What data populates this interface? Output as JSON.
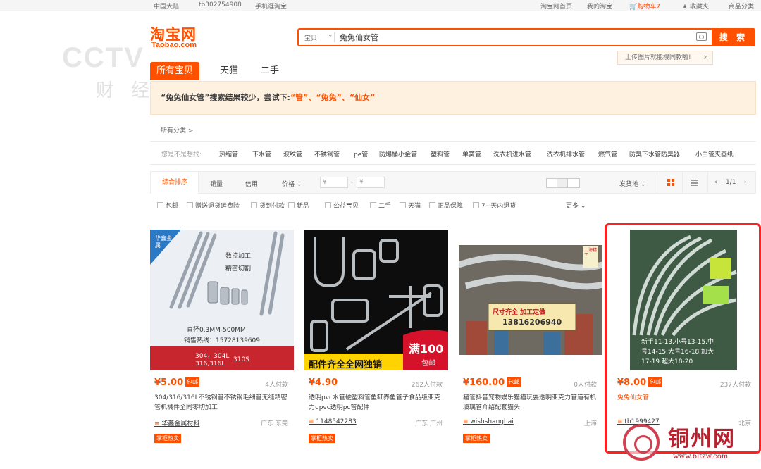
{
  "topbar": {
    "region": "中国大陆",
    "user": "tb302754908",
    "mobile": "手机逛淘宝",
    "home": "淘宝网首页",
    "my": "我的淘宝",
    "cart": "购物车7",
    "fav": "收藏夹",
    "cats": "商品分类"
  },
  "logo": {
    "title": "淘宝网",
    "sub": "Taobao.com"
  },
  "watermark_cctv": {
    "main": "CCTV",
    "sub": "财经"
  },
  "search": {
    "scope": "宝贝",
    "query": "兔兔仙女管",
    "button": "搜 索",
    "tip": "上传图片就能搜同款啦!"
  },
  "tabs": [
    "所有宝贝",
    "天猫",
    "二手"
  ],
  "notice": {
    "prefix": "“兔兔仙女管”搜索结果较少，尝试下:",
    "suggestions": "“管”、“兔兔”、“仙女”"
  },
  "all_categories": "所有分类 >",
  "want": {
    "label": "您是不是想找:",
    "keywords": [
      "热缩管",
      "下水管",
      "波纹管",
      "不锈钢管",
      "pe管",
      "防爆桶小金管",
      "塑料管",
      "单簧管",
      "洗衣机进水管",
      "洗衣机排水管",
      "燃气管",
      "防臭下水管防臭器",
      "小白管夹画纸"
    ]
  },
  "sortbar": {
    "items": [
      "综合排序",
      "销量",
      "信用",
      "价格"
    ],
    "price_from": "¥",
    "price_to": "¥",
    "ship": "发货地",
    "page": "1/1"
  },
  "filters": [
    "包邮",
    "赠送退货运费险",
    "货到付款",
    "新品",
    "公益宝贝",
    "二手",
    "天猫",
    "正品保障",
    "7+天内退货",
    "更多"
  ],
  "products": [
    {
      "price": "¥5.00",
      "badge": "包邮",
      "sold": "4人付款",
      "title": "304/316/316L不锈钢管不锈钢毛细管无缝精密管机械件全同零切加工",
      "shop": "华鑫金属材料",
      "loc": "广东 东莞",
      "tag": "掌柜热卖",
      "img_text": {
        "brand": "华鑫金属",
        "l1": "数控加工",
        "l2": "精密切割",
        "l3": "直径0.3MM-500MM",
        "l4": "销售热线：15728139609",
        "l5": "304，304L",
        "l6": "316,316L",
        "l7": "310S"
      }
    },
    {
      "price": "¥4.90",
      "badge": "",
      "sold": "262人付款",
      "title": "透明pvc水管硬塑料管鱼缸养鱼管子食品级亚克力upvc透明pc管配件",
      "shop": "1148542283",
      "loc": "广东 广州",
      "tag": "掌柜热卖",
      "img_text": {
        "banner": "配件齐全全网独销",
        "man": "满100",
        "bao": "包邮"
      }
    },
    {
      "price": "¥160.00",
      "badge": "包邮",
      "sold": "0人付款",
      "title": "猫管抖音宠物娱乐猫猫玩耍透明亚克力管道有机玻璃管介绍配套猫头",
      "shop": "wishshanghai",
      "loc": "上海",
      "tag": "掌柜热卖",
      "img_text": {
        "sign1": "尺寸齐全 加工定做",
        "sign2": "13816206940",
        "corner": "上海精工"
      }
    },
    {
      "price": "¥8.00",
      "badge": "包邮",
      "sold": "237人付款",
      "title": "兔兔仙女管",
      "shop": "tb1999427",
      "loc": "北京",
      "tag": "",
      "img_text": {
        "l1": "新手11-13.小号13-15.中",
        "l2": "号14-15.大号16-18.加大",
        "l3": "17-19.超大18-20"
      }
    }
  ],
  "watermark_site": {
    "name": "铜州网",
    "url": "www.bltzw.com"
  },
  "colors": {
    "brand": "#ff5000",
    "highlight_box": "#ff2020"
  }
}
